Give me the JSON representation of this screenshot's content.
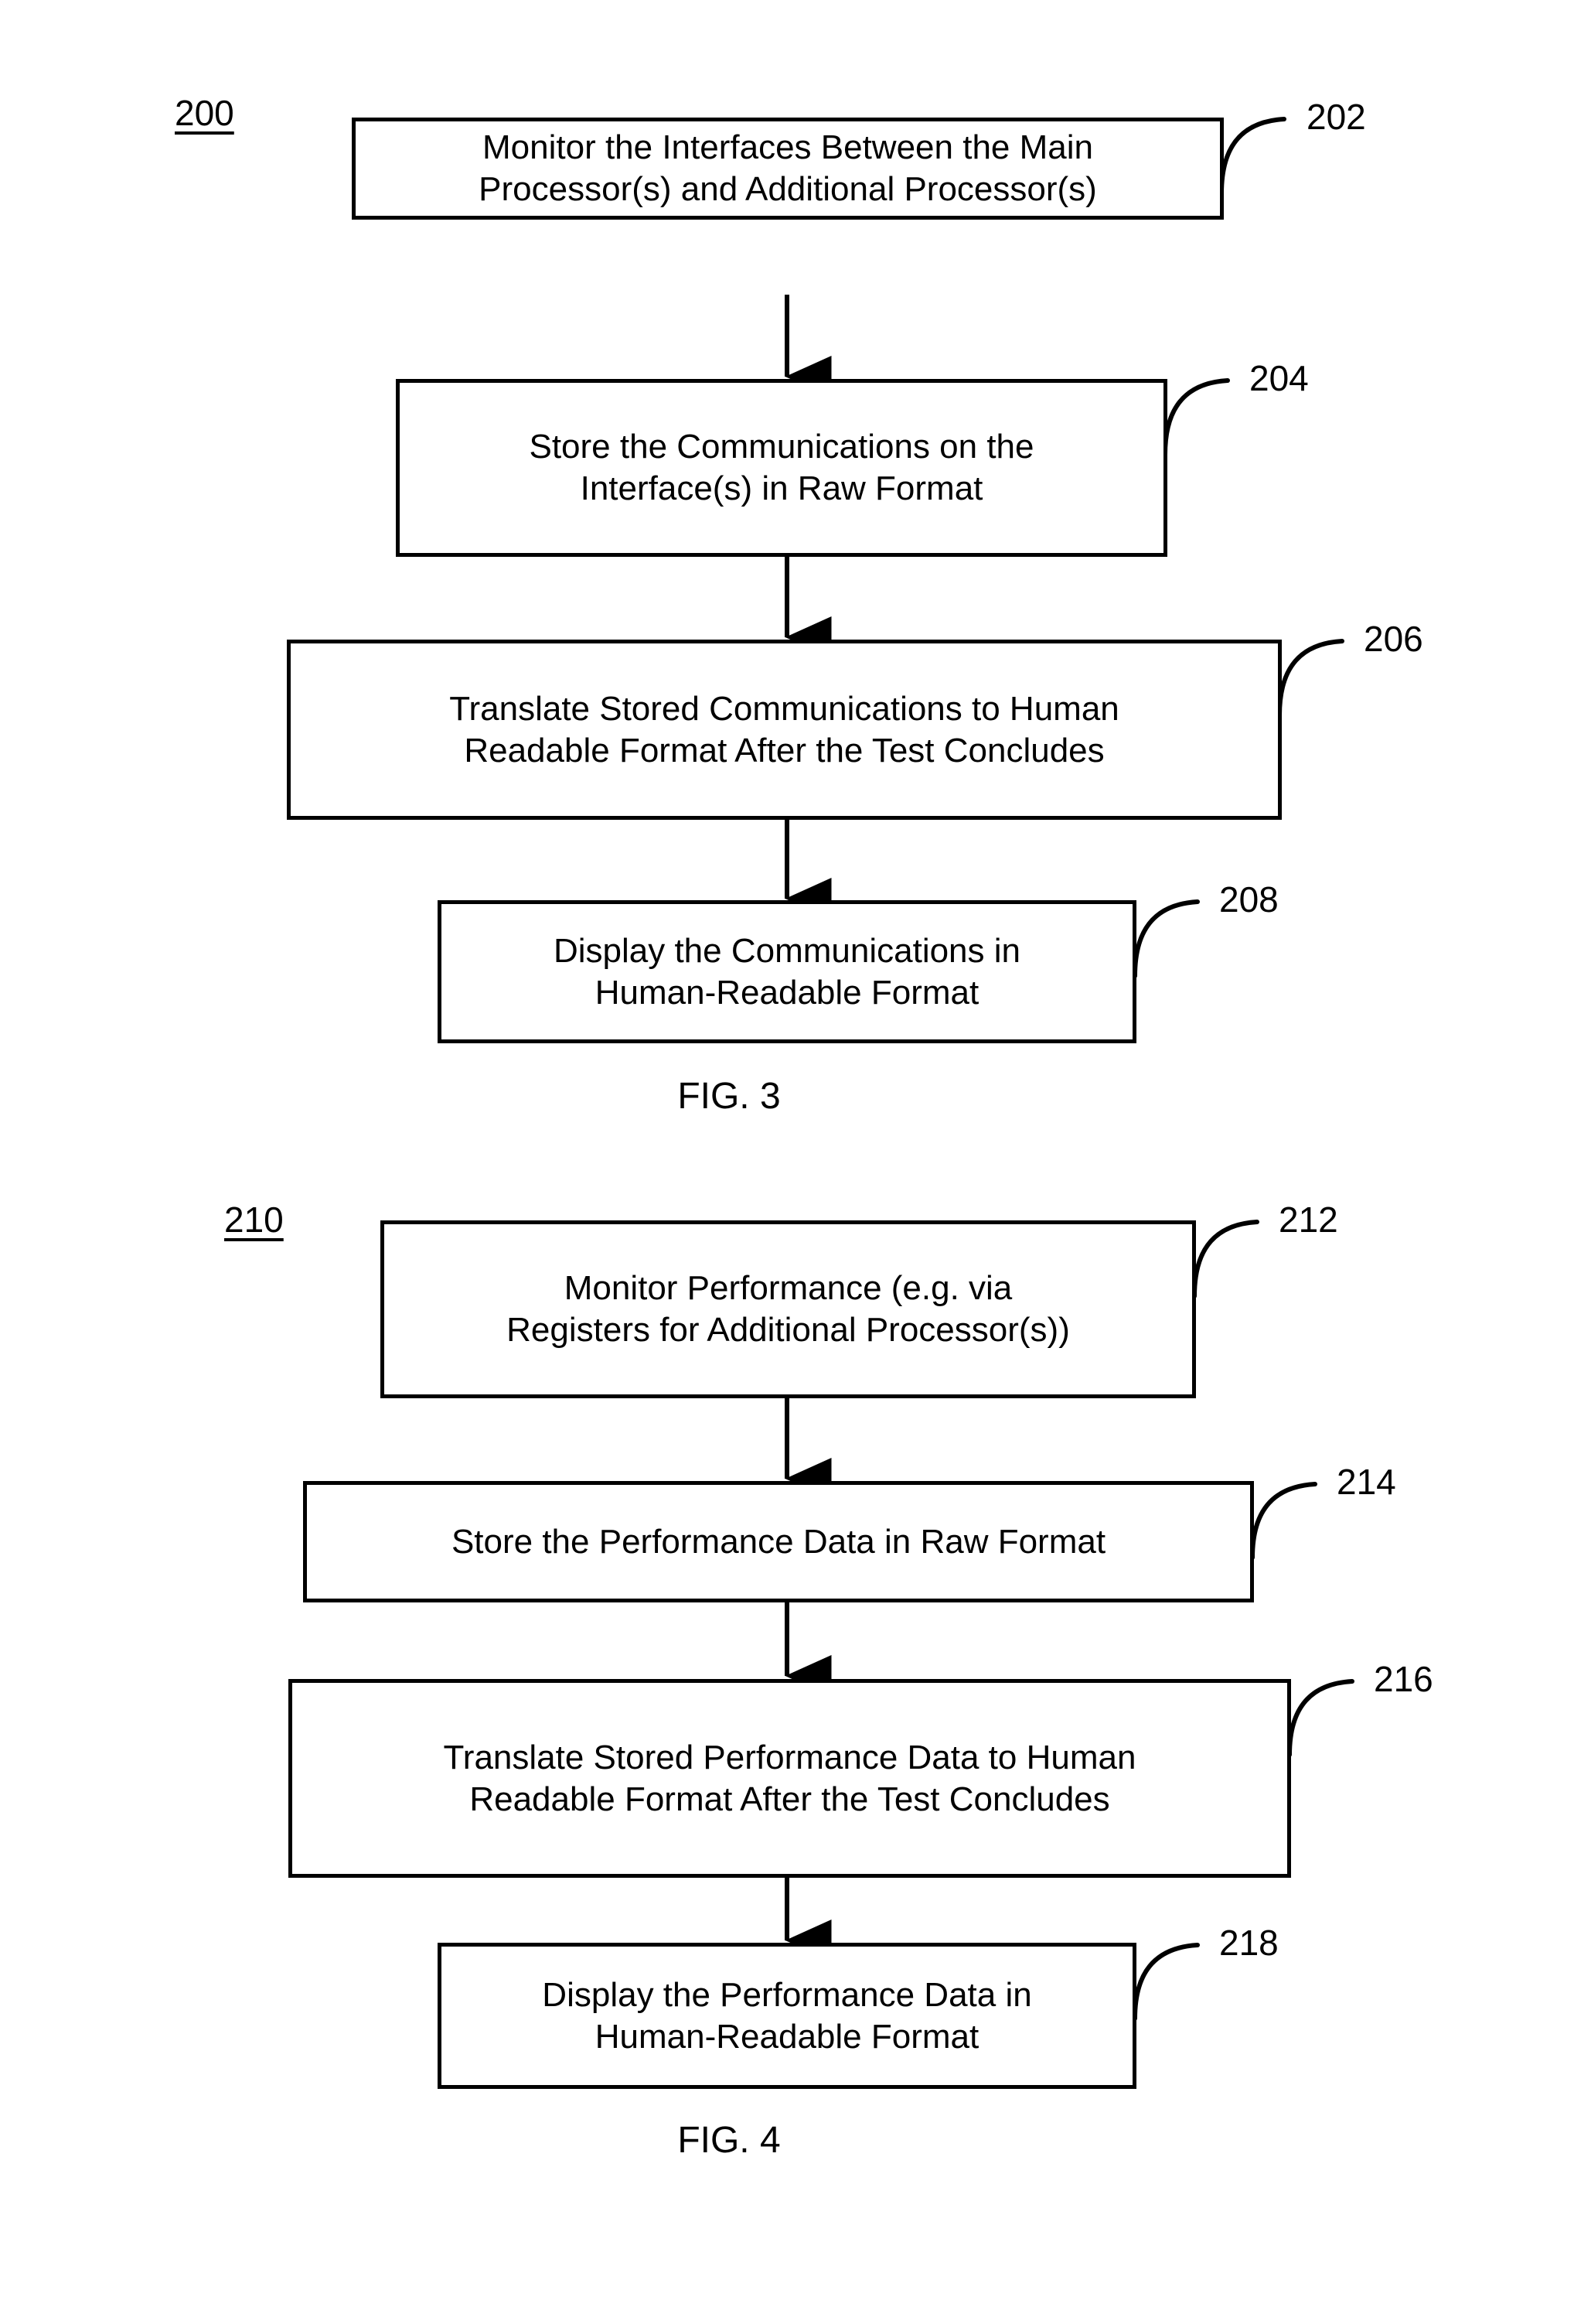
{
  "document": {
    "type": "patent-figure-sheet",
    "background_color": "#ffffff",
    "line_color": "#000000"
  },
  "figures": [
    {
      "id": "fig-3",
      "caption": "FIG. 3",
      "flow_id": "200",
      "steps": [
        {
          "ref": "202",
          "text": "Monitor the Interfaces Between the Main\nProcessor(s) and Additional Processor(s)"
        },
        {
          "ref": "204",
          "text": "Store the Communications on the\nInterface(s) in Raw Format"
        },
        {
          "ref": "206",
          "text": "Translate Stored Communications to Human\nReadable Format After the Test Concludes"
        },
        {
          "ref": "208",
          "text": "Display the Communications in\nHuman-Readable Format"
        }
      ]
    },
    {
      "id": "fig-4",
      "caption": "FIG. 4",
      "flow_id": "210",
      "steps": [
        {
          "ref": "212",
          "text": "Monitor Performance (e.g. via\nRegisters for Additional Processor(s))"
        },
        {
          "ref": "214",
          "text": "Store the Performance Data in Raw Format"
        },
        {
          "ref": "216",
          "text": "Translate Stored Performance Data to Human\nReadable Format After the Test Concludes"
        },
        {
          "ref": "218",
          "text": "Display the Performance Data in\nHuman-Readable Format"
        }
      ]
    }
  ]
}
